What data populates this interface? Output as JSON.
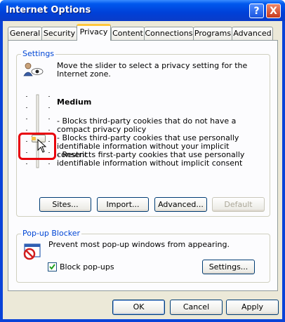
{
  "window": {
    "title": "Internet Options",
    "help_glyph": "?",
    "close_glyph": "X"
  },
  "tabs": [
    {
      "label": "General",
      "selected": false
    },
    {
      "label": "Security",
      "selected": false
    },
    {
      "label": "Privacy",
      "selected": true
    },
    {
      "label": "Content",
      "selected": false
    },
    {
      "label": "Connections",
      "selected": false
    },
    {
      "label": "Programs",
      "selected": false
    },
    {
      "label": "Advanced",
      "selected": false
    }
  ],
  "settings": {
    "group_label": "Settings",
    "instruction": "Move the slider to select a privacy setting for the Internet zone.",
    "level_title": "Medium",
    "descriptions": [
      "- Blocks third-party cookies that do not have a compact privacy policy",
      "- Blocks third-party cookies that use personally identifiable information without your implicit consent",
      "- Restricts first-party cookies that use personally identifiable information without implicit consent"
    ],
    "slider_level": 0.4,
    "buttons": {
      "sites": "Sites...",
      "import": "Import...",
      "advanced": "Advanced...",
      "default": "Default"
    }
  },
  "popup": {
    "group_label": "Pop-up Blocker",
    "description": "Prevent most pop-up windows from appearing.",
    "checkbox_label": "Block pop-ups",
    "checked": true,
    "settings_button": "Settings..."
  },
  "footer": {
    "ok": "OK",
    "cancel": "Cancel",
    "apply": "Apply"
  },
  "highlight_color": "#e8000b"
}
